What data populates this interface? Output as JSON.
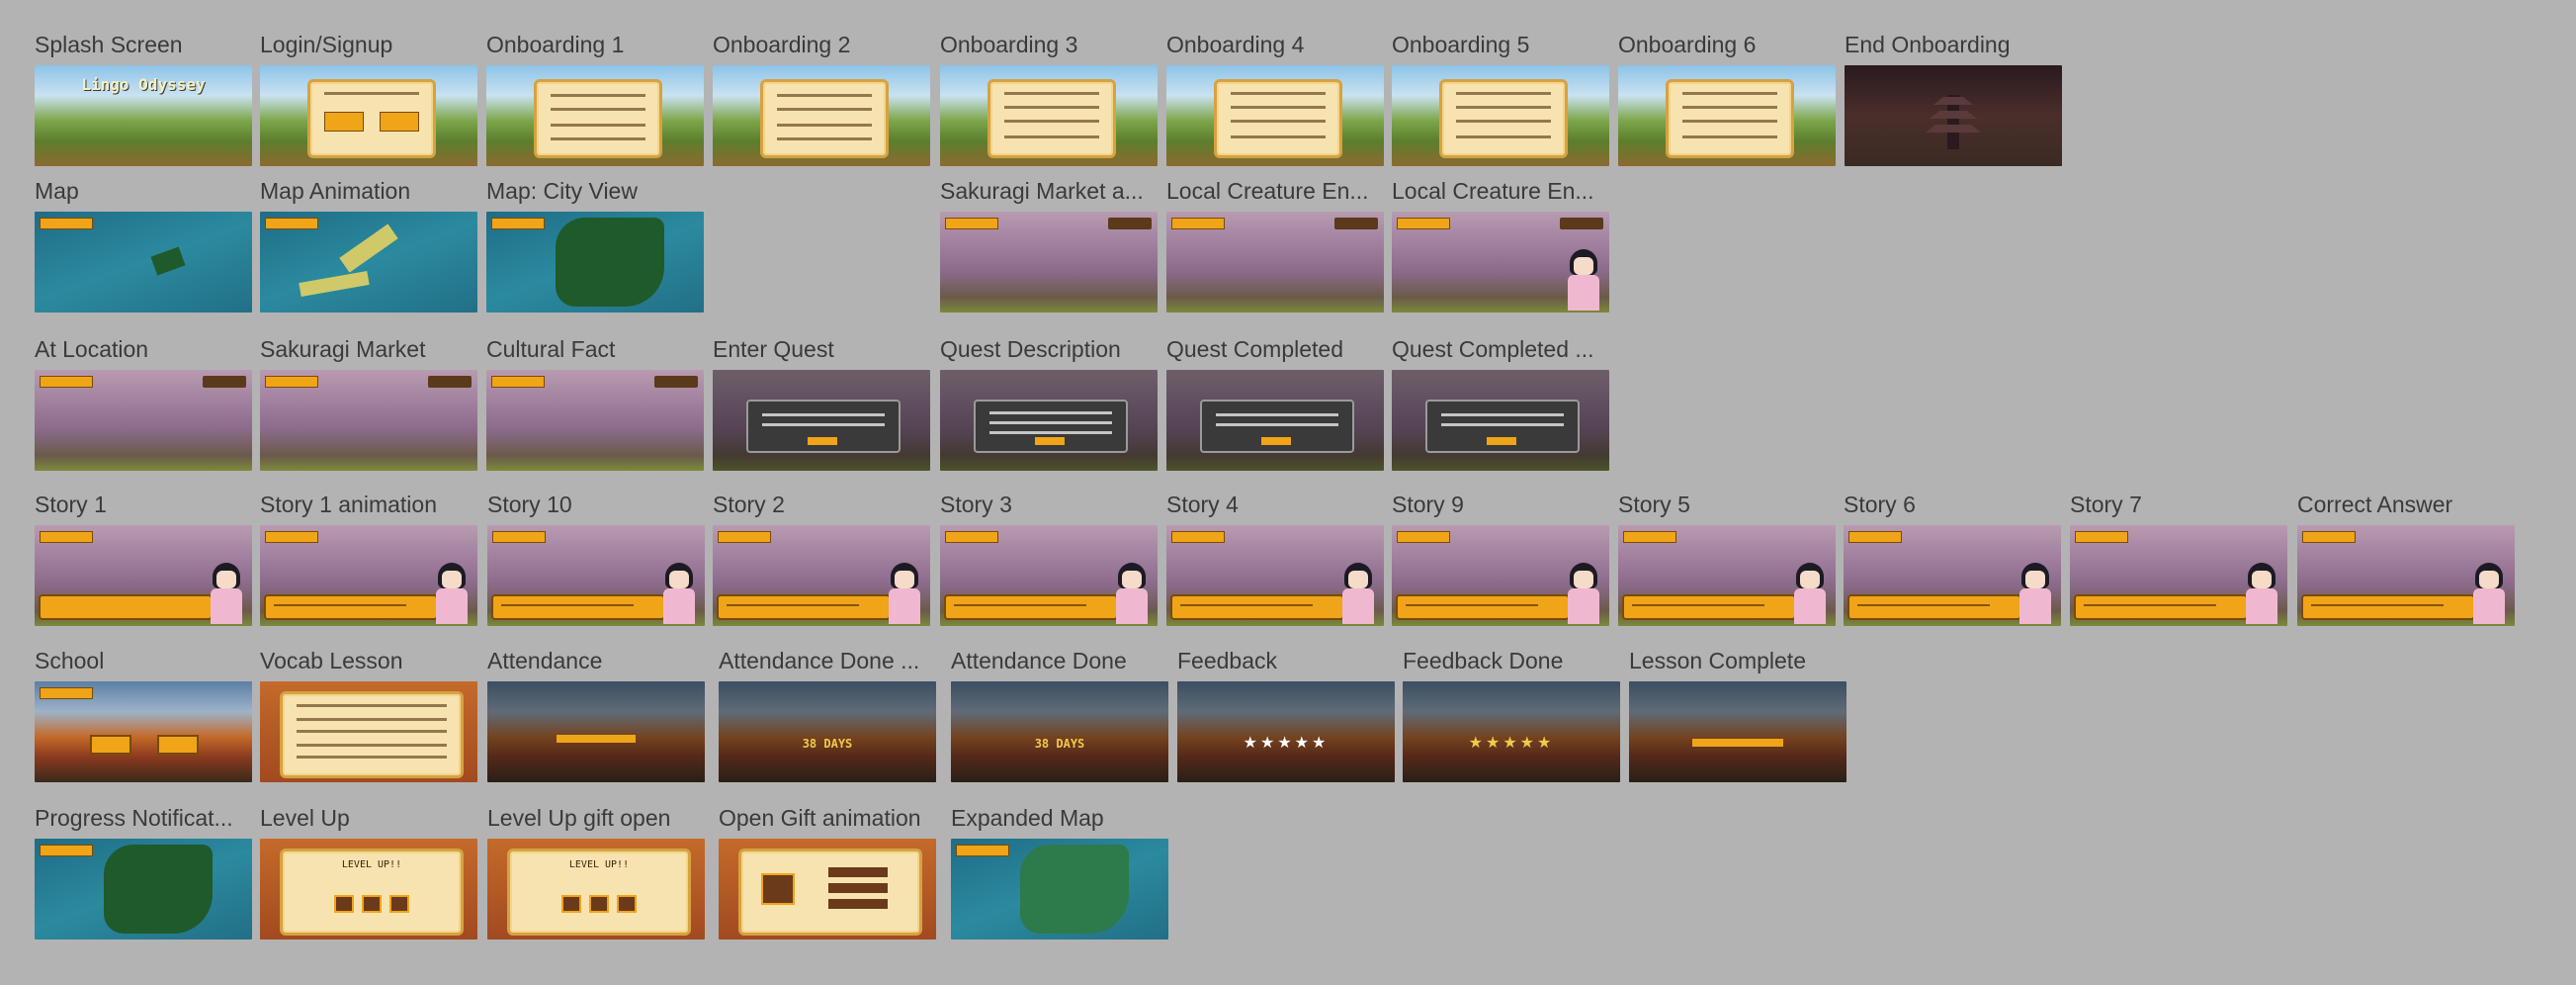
{
  "canvas": {
    "background_color": "#b3b3b3",
    "label_color": "#3a3a3a"
  },
  "frames": {
    "splash_screen": {
      "label": "Splash Screen",
      "logo_title": "Lingo Odyssey"
    },
    "login_signup": {
      "label": "Login/Signup"
    },
    "onboarding_1": {
      "label": "Onboarding 1"
    },
    "onboarding_2": {
      "label": "Onboarding 2"
    },
    "onboarding_3": {
      "label": "Onboarding 3"
    },
    "onboarding_4": {
      "label": "Onboarding 4"
    },
    "onboarding_5": {
      "label": "Onboarding 5"
    },
    "onboarding_6": {
      "label": "Onboarding 6"
    },
    "end_onboarding": {
      "label": "End Onboarding"
    },
    "map": {
      "label": "Map"
    },
    "map_animation": {
      "label": "Map Animation"
    },
    "map_city_view": {
      "label": "Map: City View"
    },
    "sakuragi_market_a": {
      "label": "Sakuragi Market a..."
    },
    "local_creature_en_1": {
      "label": "Local Creature En..."
    },
    "local_creature_en_2": {
      "label": "Local Creature En..."
    },
    "at_location": {
      "label": "At Location"
    },
    "sakuragi_market": {
      "label": "Sakuragi Market"
    },
    "cultural_fact": {
      "label": "Cultural Fact"
    },
    "enter_quest": {
      "label": "Enter Quest"
    },
    "quest_description": {
      "label": "Quest Description"
    },
    "quest_completed": {
      "label": "Quest Completed"
    },
    "quest_completed_2": {
      "label": "Quest Completed ..."
    },
    "story_1": {
      "label": "Story 1"
    },
    "story_1_animation": {
      "label": "Story 1 animation"
    },
    "story_10": {
      "label": "Story 10"
    },
    "story_2": {
      "label": "Story 2"
    },
    "story_3": {
      "label": "Story 3"
    },
    "story_4": {
      "label": "Story 4"
    },
    "story_9": {
      "label": "Story 9"
    },
    "story_5": {
      "label": "Story 5"
    },
    "story_6": {
      "label": "Story 6"
    },
    "story_7": {
      "label": "Story 7"
    },
    "correct_answer": {
      "label": "Correct Answer"
    },
    "school": {
      "label": "School"
    },
    "vocab_lesson": {
      "label": "Vocab Lesson"
    },
    "attendance": {
      "label": "Attendance"
    },
    "attendance_done_2": {
      "label": "Attendance Done ...",
      "days": "38 DAYS"
    },
    "attendance_done": {
      "label": "Attendance Done",
      "days": "38 DAYS"
    },
    "feedback": {
      "label": "Feedback",
      "stars": "★★★★★"
    },
    "feedback_done": {
      "label": "Feedback Done",
      "stars": "★★★★★"
    },
    "lesson_complete": {
      "label": "Lesson Complete"
    },
    "progress_notification": {
      "label": "Progress Notificat..."
    },
    "level_up": {
      "label": "Level Up",
      "title": "LEVEL UP!!"
    },
    "level_up_gift_open": {
      "label": "Level Up gift open",
      "title": "LEVEL UP!!"
    },
    "open_gift_animation": {
      "label": "Open Gift animation"
    },
    "expanded_map": {
      "label": "Expanded Map"
    }
  }
}
